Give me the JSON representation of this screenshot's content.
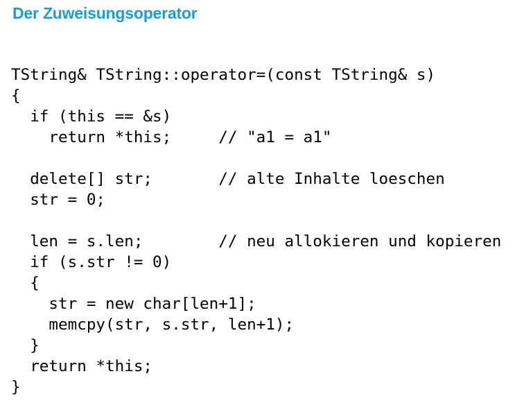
{
  "slide": {
    "title": "Der Zuweisungsoperator",
    "code_lines": [
      "TString& TString::operator=(const TString& s)",
      "{",
      "  if (this == &s)",
      "    return *this;     // \"a1 = a1\"",
      "",
      "  delete[] str;       // alte Inhalte loeschen",
      "  str = 0;",
      "",
      "  len = s.len;        // neu allokieren und kopieren",
      "  if (s.str != 0)",
      "  {",
      "    str = new char[len+1];",
      "    memcpy(str, s.str, len+1);",
      "  }",
      "  return *this;",
      "}"
    ]
  }
}
